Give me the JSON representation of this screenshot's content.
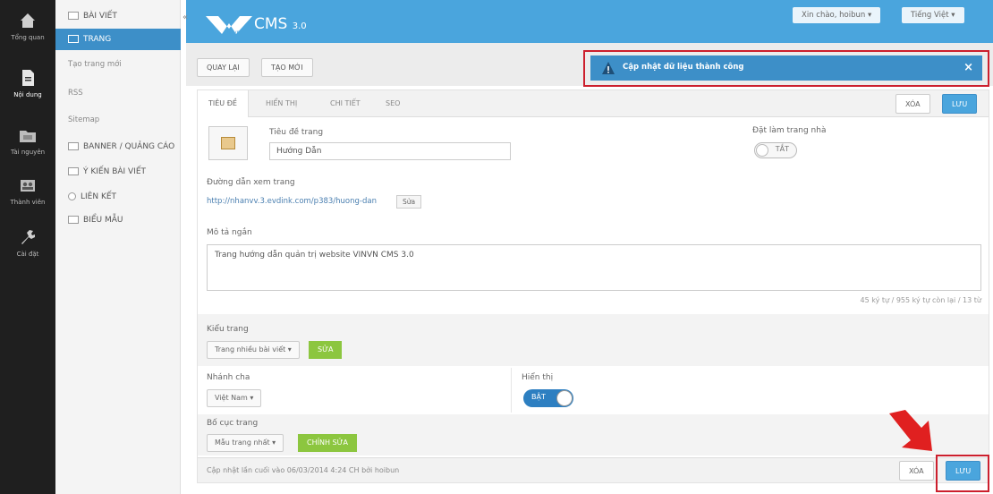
{
  "rail": {
    "items": [
      {
        "label": "Tổng quan",
        "icon": "home-icon"
      },
      {
        "label": "Nội dung",
        "icon": "document-icon",
        "active": true
      },
      {
        "label": "Tài nguyên",
        "icon": "folder-icon"
      },
      {
        "label": "Thành viên",
        "icon": "people-icon"
      },
      {
        "label": "Cài đặt",
        "icon": "wrench-icon"
      }
    ]
  },
  "sidebar": {
    "items": [
      {
        "label": "Bài viết",
        "type": "head"
      },
      {
        "label": "Trang",
        "type": "active"
      },
      {
        "label": "Tạo trang mới",
        "type": "sub"
      },
      {
        "label": "RSS",
        "type": "sub"
      },
      {
        "label": "Sitemap",
        "type": "sub"
      },
      {
        "label": "Banner / quảng cáo",
        "type": "head"
      },
      {
        "label": "Ý kiến bài viết",
        "type": "head"
      },
      {
        "label": "Liên kết",
        "type": "head"
      },
      {
        "label": "Biểu mẫu",
        "type": "head"
      }
    ]
  },
  "header": {
    "brand": "CMS",
    "version": "3.0",
    "logo_small": "vinyn",
    "user_dropdown": "Xin chào, hoibun",
    "lang_dropdown": "Tiếng Việt"
  },
  "toolbar": {
    "back_label": "Quay lại",
    "new_label": "Tạo mới"
  },
  "notice": {
    "message": "Cập nhật dữ liệu thành công",
    "close": "×",
    "color": "#3d8fc8",
    "frame_color": "#cc1f2d"
  },
  "tabs": [
    "Tiêu đề",
    "Hiển thị",
    "Chi tiết",
    "SEO"
  ],
  "actions": {
    "delete_label": "Xóa",
    "save_label": "Lưu"
  },
  "form": {
    "title_label": "Tiêu đề trang",
    "title_value": "Hướng Dẫn",
    "homepage_label": "Đặt làm trang nhà",
    "homepage_toggle": "TẮT",
    "url_label": "Đường dẫn xem trang",
    "url_value": "http://nhanvv.3.evdink.com/p383/huong-dan",
    "url_edit": "Sửa",
    "desc_label": "Mô tả ngắn",
    "desc_value": "Trang hướng dẫn quản trị website VINVN CMS 3.0",
    "counter": "45 ký tự / 955 ký tự còn lại / 13 từ",
    "type_label": "Kiểu trang",
    "type_value": "Trang nhiều bài viết",
    "type_btn": "Sửa",
    "branch_label": "Nhánh cha",
    "branch_value": "Việt Nam",
    "display_label": "Hiển thị",
    "display_toggle": "BẬT",
    "layout_label": "Bố cục trang",
    "layout_value": "Mẫu trang nhất",
    "layout_btn": "Chỉnh sửa"
  },
  "footer": {
    "meta": "Cập nhật lần cuối vào 06/03/2014 4:24 CH bởi hoibun",
    "delete_label": "Xóa",
    "save_label": "Lưu"
  },
  "colors": {
    "header": "#4aa5dd",
    "accent": "#3d8fc8",
    "green": "#8cc63f",
    "highlight": "#cc1f2d",
    "arrow": "#e02020"
  }
}
